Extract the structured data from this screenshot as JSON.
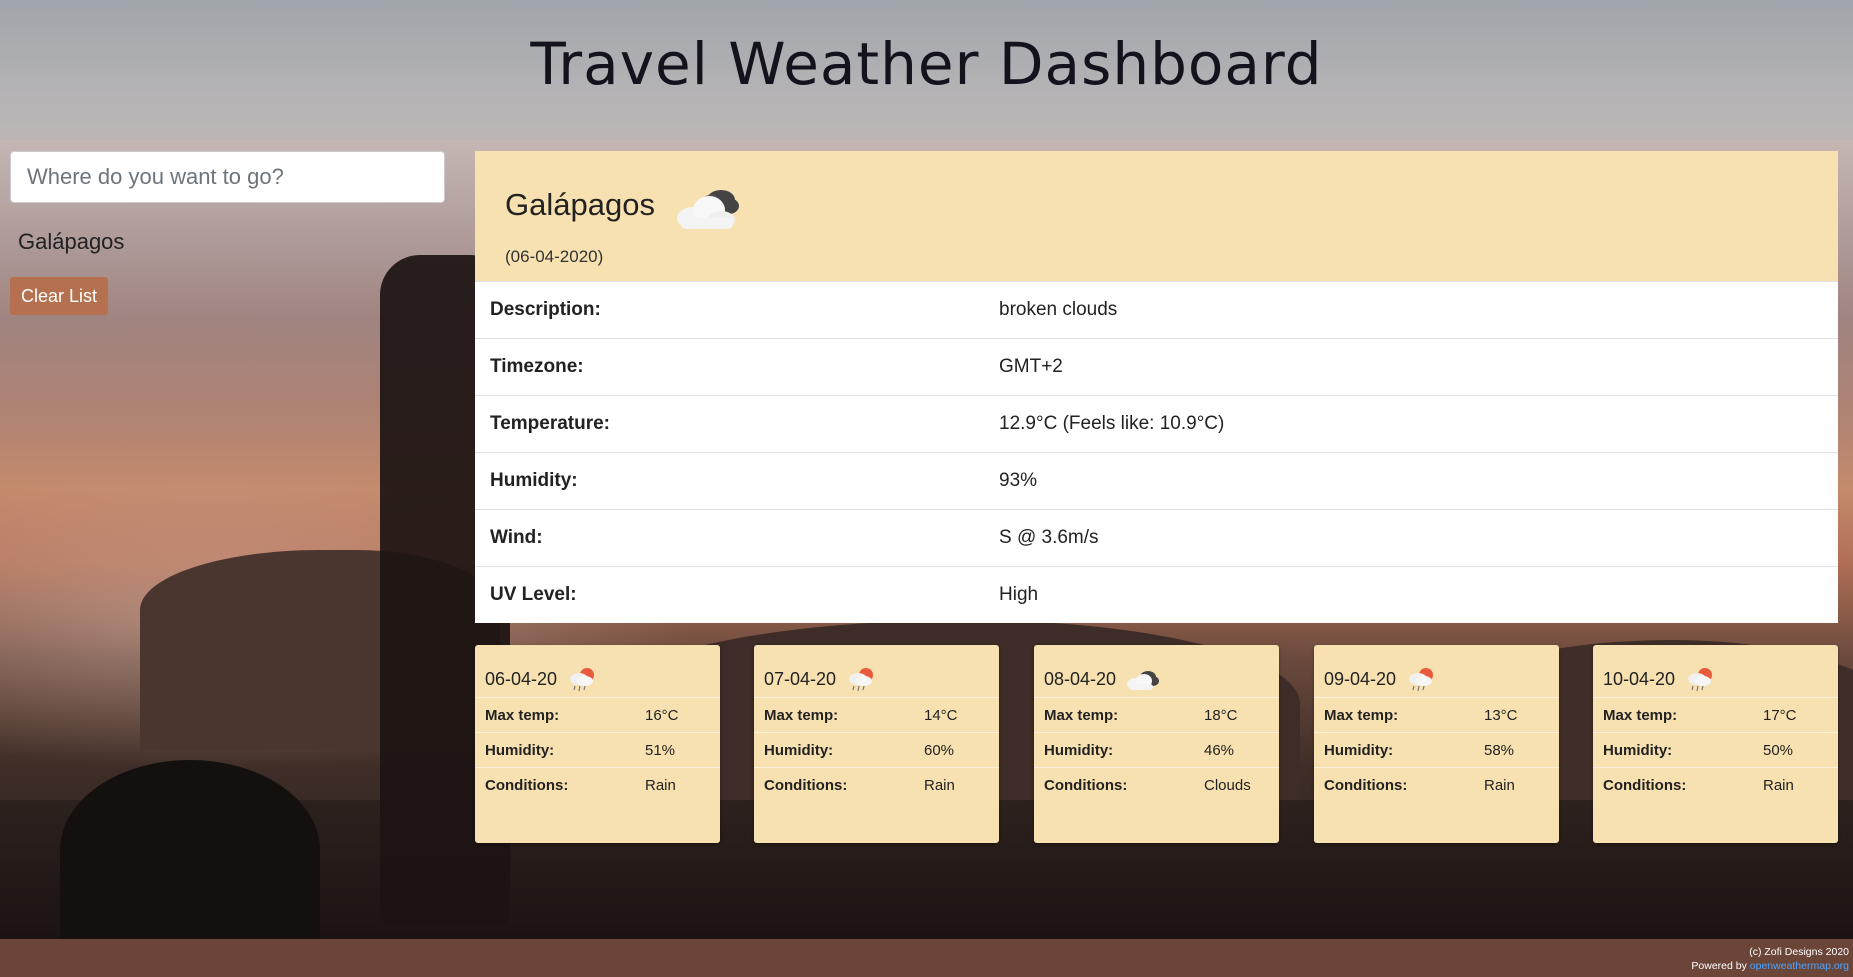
{
  "header": {
    "title": "Travel Weather Dashboard"
  },
  "search": {
    "placeholder": "Where do you want to go?"
  },
  "history": {
    "items": [
      "Galápagos"
    ],
    "clear_label": "Clear List"
  },
  "current": {
    "city": "Galápagos",
    "date": "(06-04-2020)",
    "icon": "broken-clouds-icon",
    "rows": [
      {
        "label": "Description:",
        "value": "broken clouds"
      },
      {
        "label": "Timezone:",
        "value": "GMT+2"
      },
      {
        "label": "Temperature:",
        "value": "12.9°C (Feels like: 10.9°C)"
      },
      {
        "label": "Humidity:",
        "value": "93%"
      },
      {
        "label": "Wind:",
        "value": "S @ 3.6m/s"
      },
      {
        "label": "UV Level:",
        "value": "High"
      }
    ]
  },
  "forecast_labels": {
    "max_temp": "Max temp:",
    "humidity": "Humidity:",
    "conditions": "Conditions:"
  },
  "forecast": [
    {
      "date": "06-04-20",
      "icon": "rain-icon",
      "max_temp": "16°C",
      "humidity": "51%",
      "conditions": "Rain"
    },
    {
      "date": "07-04-20",
      "icon": "rain-icon",
      "max_temp": "14°C",
      "humidity": "60%",
      "conditions": "Rain"
    },
    {
      "date": "08-04-20",
      "icon": "clouds-icon",
      "max_temp": "18°C",
      "humidity": "46%",
      "conditions": "Clouds"
    },
    {
      "date": "09-04-20",
      "icon": "rain-icon",
      "max_temp": "13°C",
      "humidity": "58%",
      "conditions": "Rain"
    },
    {
      "date": "10-04-20",
      "icon": "rain-icon",
      "max_temp": "17°C",
      "humidity": "50%",
      "conditions": "Rain"
    }
  ],
  "footer": {
    "copyright": "(c) Zofi Designs 2020",
    "powered_by": "Powered by",
    "link_text": "openweathermap.org"
  },
  "colors": {
    "card_bg": "#f8e1b1",
    "button_bg": "#b5704f",
    "footer_bg": "#6b4638",
    "link": "#4aa3ff"
  }
}
